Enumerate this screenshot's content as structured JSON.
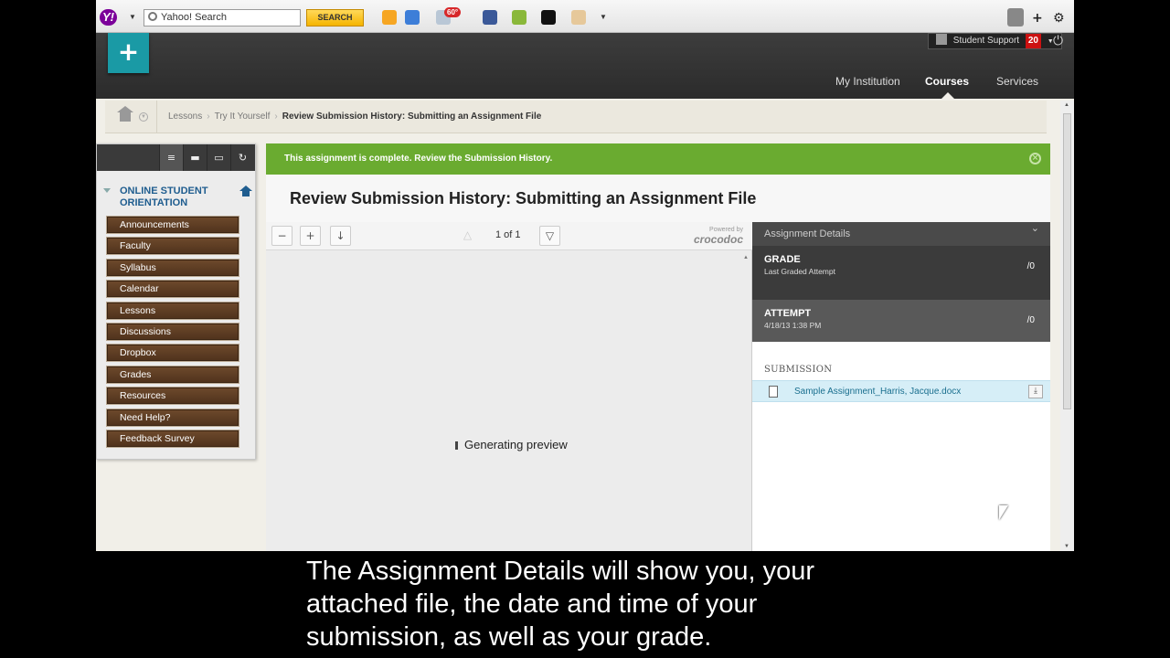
{
  "browser_toolbar": {
    "logo": "Y!",
    "search_value": "Yahoo! Search",
    "search_button": "SEARCH",
    "weather_badge": "60°"
  },
  "header": {
    "support_label": "Student Support",
    "support_count": "20",
    "nav": [
      "My Institution",
      "Courses",
      "Services"
    ],
    "active_nav": "Courses",
    "add_symbol": "+"
  },
  "breadcrumb": {
    "items": [
      "Lessons",
      "Try It Yourself"
    ],
    "current": "Review Submission History: Submitting an Assignment File"
  },
  "sidebar": {
    "title": "ONLINE STUDENT ORIENTATION",
    "menu": [
      "Announcements",
      "Faculty",
      "Syllabus",
      "Calendar",
      "Lessons",
      "Discussions",
      "Dropbox",
      "Grades",
      "Resources",
      "Need Help?",
      "Feedback Survey"
    ]
  },
  "content": {
    "alert": "This assignment is complete. Review the Submission History.",
    "title": "Review Submission History: Submitting an Assignment File",
    "page_indicator": "1 of 1",
    "powered_by": "Powered by",
    "brand": "crocodoc",
    "preview_status": "Generating preview"
  },
  "details": {
    "header": "Assignment Details",
    "grade_label": "GRADE",
    "grade_sub": "Last Graded Attempt",
    "grade_score": "/0",
    "attempt_label": "ATTEMPT",
    "attempt_date": "4/18/13 1:38 PM",
    "attempt_score": "/0",
    "submission_label": "SUBMISSION",
    "file_name": "Sample Assignment_Harris, Jacque.docx"
  },
  "caption": "The Assignment Details will show you, your\nattached file, the date and time of your\nsubmission,  as well as your grade."
}
